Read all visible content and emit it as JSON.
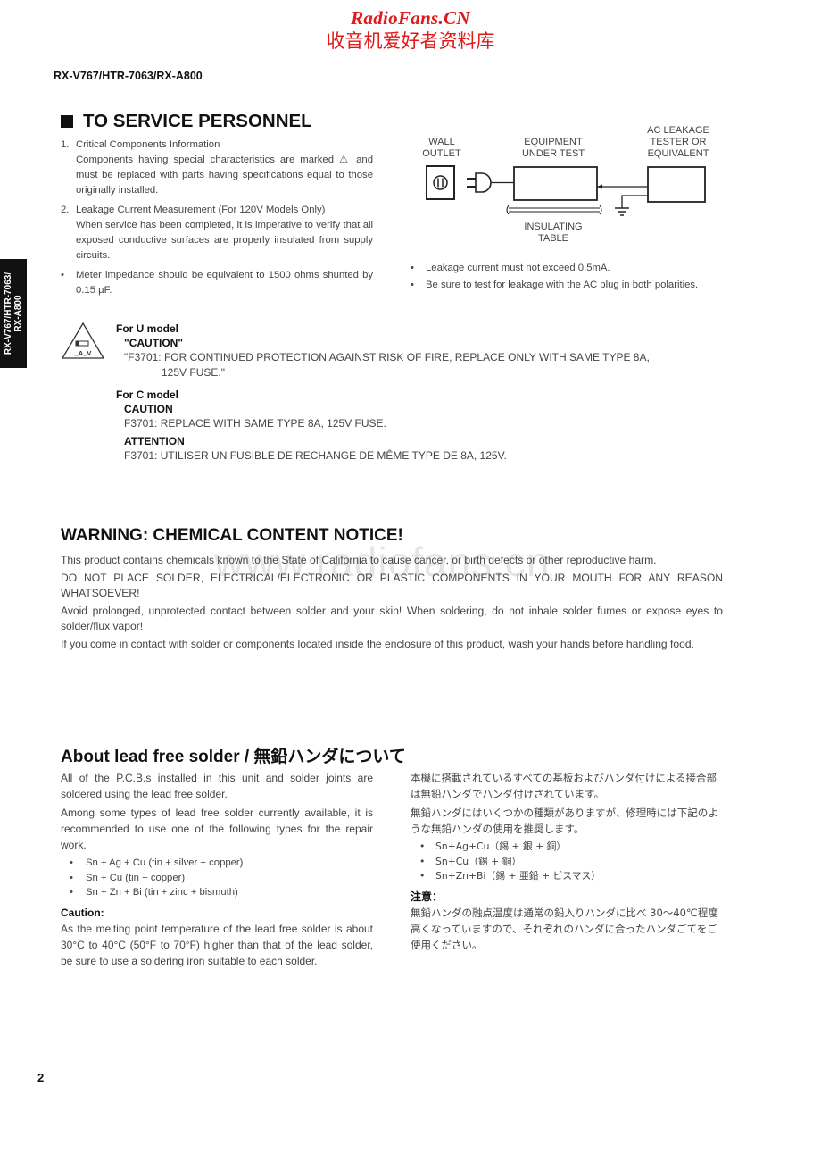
{
  "watermark": {
    "site": "RadioFans.CN",
    "site_cn": "收音机爱好者资料库",
    "mid_text": "www.radiofans.cn"
  },
  "header": {
    "model": "RX-V767/HTR-7063/RX-A800"
  },
  "side_tab": {
    "line1": "RX-V767/HTR-7063/",
    "line2": "RX-A800"
  },
  "service": {
    "title": "TO SERVICE PERSONNEL",
    "items": [
      {
        "num": "1.",
        "title": "Critical Components Information",
        "body": "Components having special characteristics are marked ⚠ and must be replaced with parts having specifications equal to those originally installed."
      },
      {
        "num": "2.",
        "title": "Leakage Current Measurement (For 120V Models Only)",
        "body": "When service has been completed, it is imperative to verify that all exposed conductive surfaces are properly insulated from supply circuits."
      }
    ],
    "left_bullet": "Meter impedance should be equivalent to 1500 ohms shunted by 0.15 µF.",
    "right_bullets": [
      "Leakage current must not exceed 0.5mA.",
      "Be sure to test for leakage with the AC plug in both polarities."
    ],
    "diagram": {
      "wall_outlet": [
        "WALL",
        "OUTLET"
      ],
      "equipment": [
        "EQUIPMENT",
        "UNDER TEST"
      ],
      "tester": [
        "AC LEAKAGE",
        "TESTER OR",
        "EQUIVALENT"
      ],
      "table": [
        "INSULATING",
        "TABLE"
      ]
    }
  },
  "fuse": {
    "icon_label": "A V",
    "u_model": {
      "label": "For U model",
      "caution": "\"CAUTION\"",
      "text_line1": "\"F3701: FOR CONTINUED PROTECTION AGAINST RISK OF FIRE, REPLACE ONLY WITH SAME TYPE 8A,",
      "text_line2": "125V FUSE.\""
    },
    "c_model": {
      "label": "For C model",
      "caution": "CAUTION",
      "caution_text": "F3701:  REPLACE WITH SAME TYPE 8A, 125V FUSE.",
      "attention": "ATTENTION",
      "attention_text": "F3701:  UTILISER UN FUSIBLE DE RECHANGE DE MÊME TYPE DE 8A, 125V."
    }
  },
  "warning": {
    "title": "WARNING: CHEMICAL CONTENT NOTICE!",
    "paragraphs": [
      "This product contains chemicals known to the State of California to cause cancer, or birth defects or other reproductive harm.",
      "DO NOT PLACE SOLDER, ELECTRICAL/ELECTRONIC OR PLASTIC COMPONENTS IN YOUR MOUTH FOR ANY REASON WHATSOEVER!",
      "Avoid prolonged, unprotected contact between solder and your skin! When soldering, do not inhale solder fumes or expose eyes to solder/flux vapor!",
      "If you come in contact with solder or components located inside the enclosure of this product, wash your hands before handling food."
    ]
  },
  "lead_free": {
    "title": "About lead free solder / 無鉛ハンダについて",
    "en": {
      "p1": "All of the P.C.B.s installed in this unit and solder joints are soldered using the lead free solder.",
      "p2": "Among some types of lead free solder currently available, it is recommended to use one of the following types for the repair work.",
      "types": [
        "Sn + Ag + Cu (tin + silver + copper)",
        "Sn + Cu (tin + copper)",
        "Sn + Zn + Bi (tin + zinc + bismuth)"
      ],
      "caution_title": "Caution:",
      "caution_text": "As the melting point temperature of the lead free solder is about 30°C to 40°C (50°F to 70°F) higher than that of the lead solder, be sure to use a soldering iron suitable to each solder."
    },
    "jp": {
      "p1": "本機に搭載されているすべての基板およびハンダ付けによる接合部は無鉛ハンダでハンダ付けされています。",
      "p2": "無鉛ハンダにはいくつかの種類がありますが、修理時には下記のような無鉛ハンダの使用を推奨します。",
      "types": [
        "Sn+Ag+Cu（錫 + 銀 + 銅）",
        "Sn+Cu（錫 + 銅）",
        "Sn+Zn+Bi（錫 + 亜鉛 + ビスマス）"
      ],
      "caution_title": "注意：",
      "caution_text": "無鉛ハンダの融点温度は通常の鉛入りハンダに比べ 30～40℃程度高くなっていますので、それぞれのハンダに合ったハンダごてをご使用ください。"
    }
  },
  "footer": {
    "page_number": "2"
  }
}
